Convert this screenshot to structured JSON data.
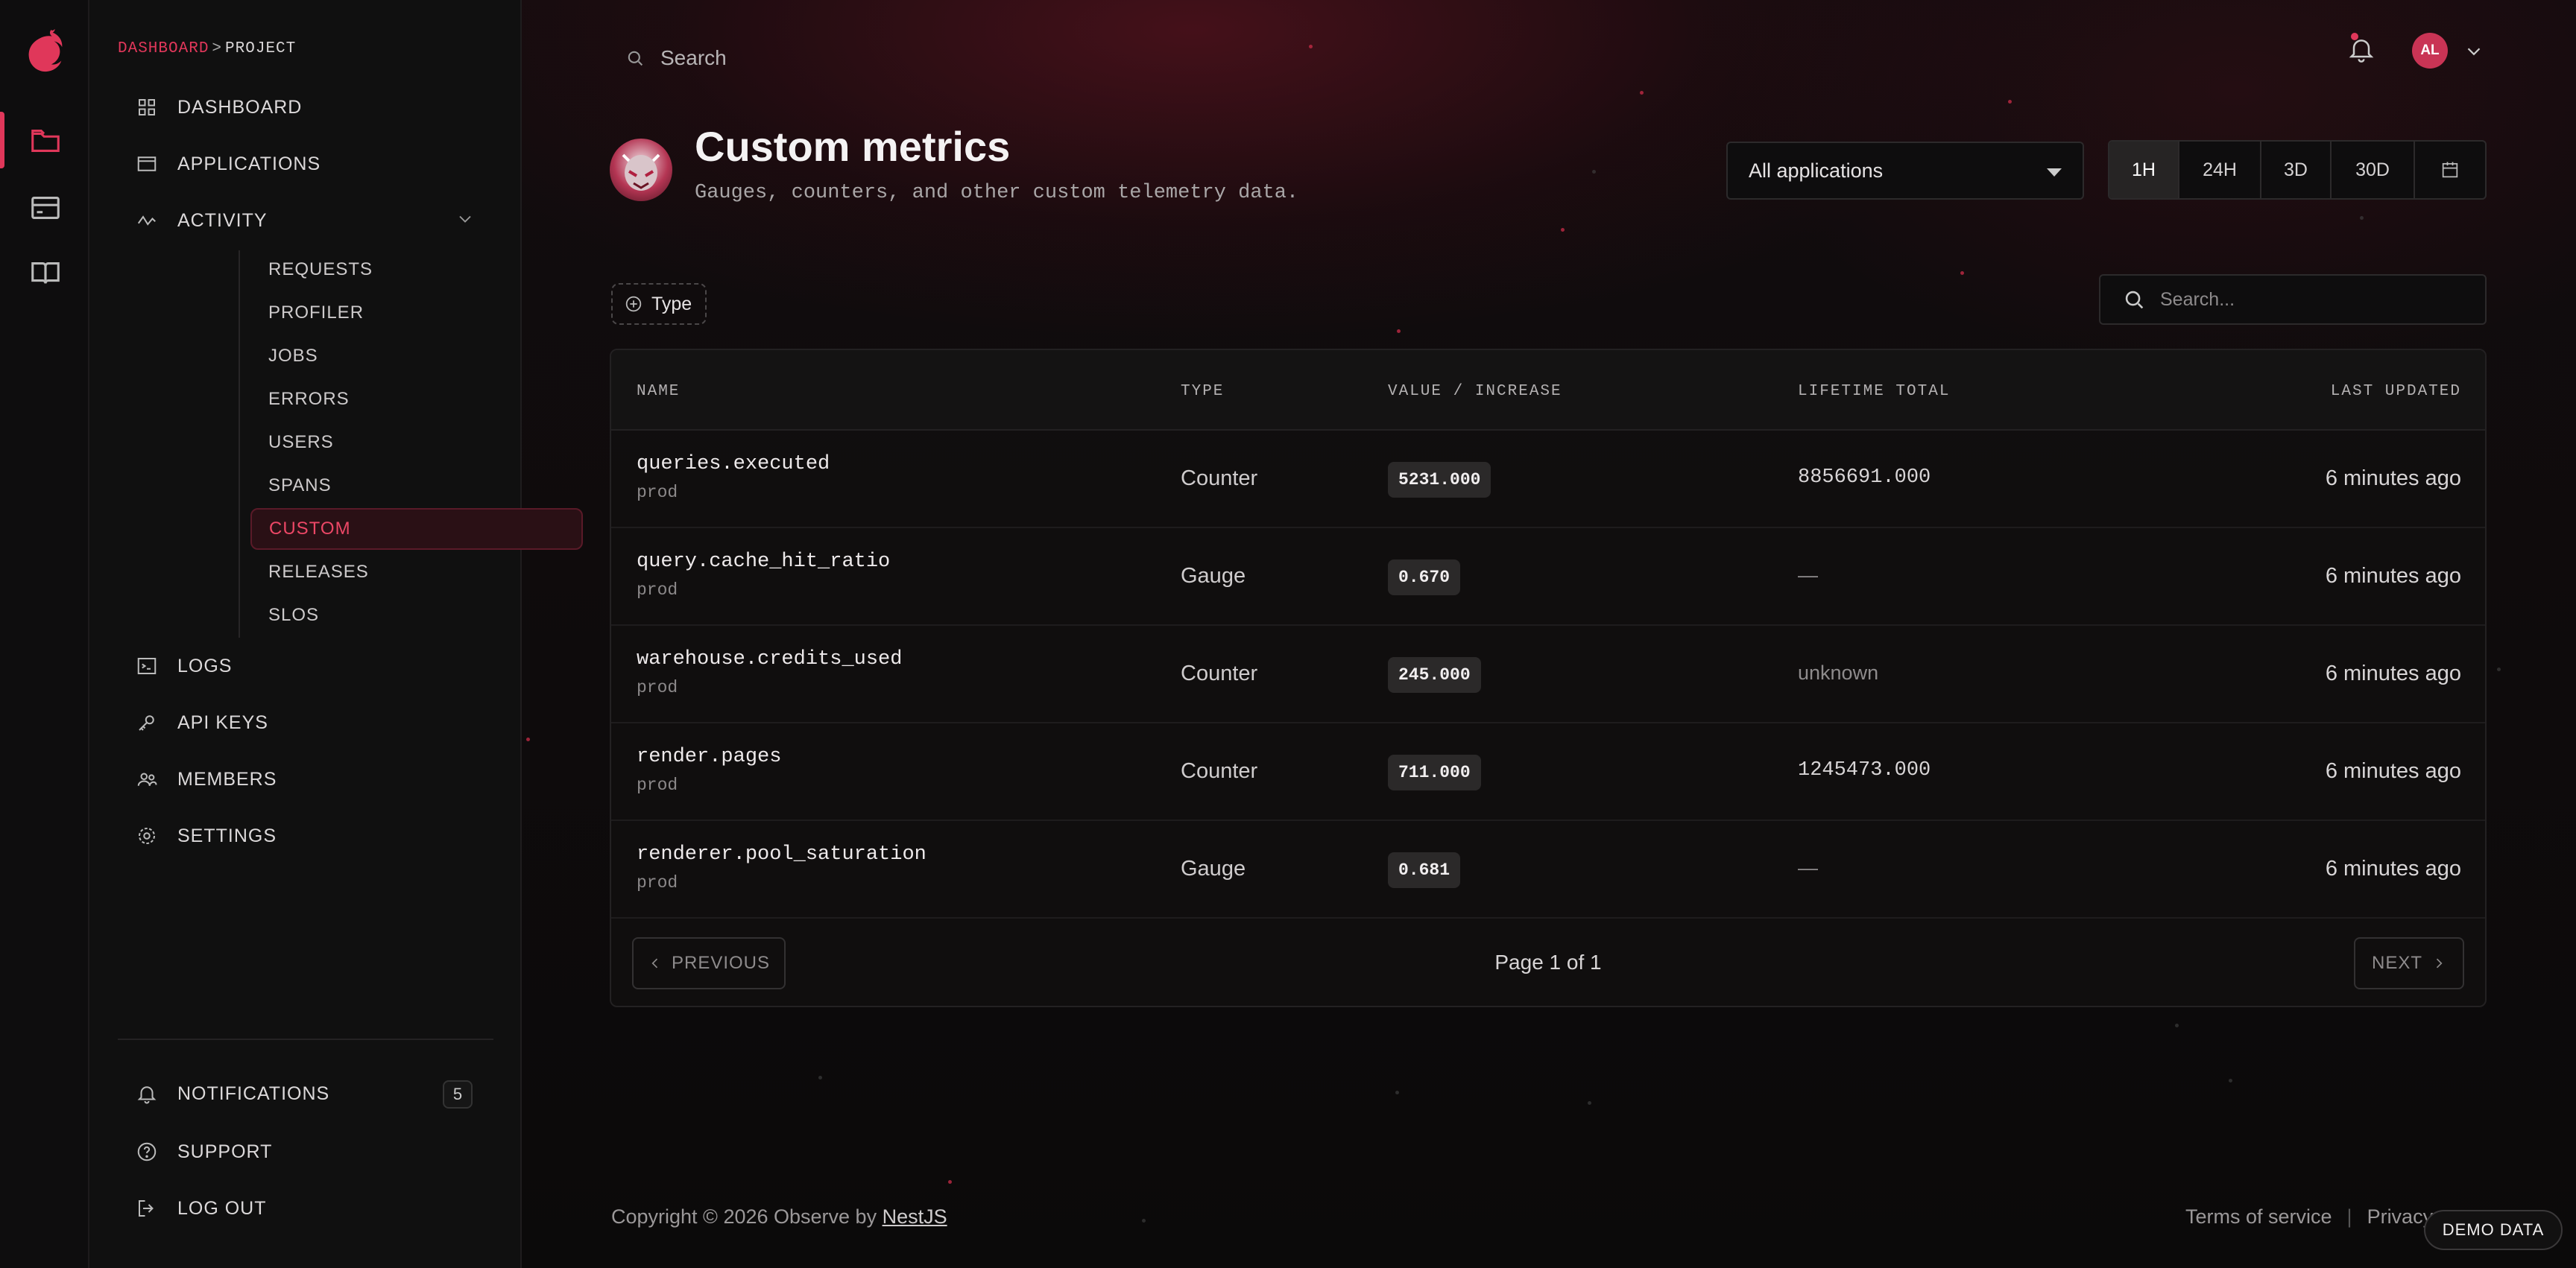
{
  "colors": {
    "accent": "#e0375a",
    "background": "#0c0a0b",
    "surface": "#101010"
  },
  "rail": {
    "icons": [
      "nestjs-logo-icon",
      "folder-icon",
      "card-icon",
      "book-icon"
    ]
  },
  "breadcrumb": {
    "root": "DASHBOARD",
    "separator": ">",
    "current": "PROJECT"
  },
  "sidebar": {
    "items": [
      {
        "label": "DASHBOARD",
        "icon": "grid-icon"
      },
      {
        "label": "APPLICATIONS",
        "icon": "window-icon"
      },
      {
        "label": "ACTIVITY",
        "icon": "activity-icon"
      }
    ],
    "activity_sub": [
      "REQUESTS",
      "PROFILER",
      "JOBS",
      "ERRORS",
      "USERS",
      "SPANS",
      "CUSTOM",
      "RELEASES",
      "SLOS"
    ],
    "active_sub": "CUSTOM",
    "lower_items": [
      {
        "label": "LOGS",
        "icon": "terminal-icon"
      },
      {
        "label": "API KEYS",
        "icon": "key-icon"
      },
      {
        "label": "MEMBERS",
        "icon": "users-icon"
      },
      {
        "label": "SETTINGS",
        "icon": "gear-icon"
      }
    ],
    "bottom_items": [
      {
        "label": "NOTIFICATIONS",
        "icon": "bell-icon"
      },
      {
        "label": "SUPPORT",
        "icon": "help-icon"
      },
      {
        "label": "LOG OUT",
        "icon": "logout-icon"
      }
    ],
    "notifications_count": "5"
  },
  "topbar": {
    "search_placeholder": "Search",
    "avatar_initials": "AL"
  },
  "header": {
    "title": "Custom metrics",
    "subtitle": "Gauges, counters, and other custom telemetry data.",
    "app_select": "All applications",
    "ranges": [
      "1H",
      "24H",
      "3D",
      "30D"
    ],
    "active_range": "1H"
  },
  "filters": {
    "type_chip": "Type",
    "search_placeholder": "Search..."
  },
  "table": {
    "columns": [
      "NAME",
      "TYPE",
      "VALUE / INCREASE",
      "LIFETIME TOTAL",
      "LAST UPDATED"
    ],
    "rows": [
      {
        "name": "queries.executed",
        "env": "prod",
        "type": "Counter",
        "value": "5231.000",
        "total": "8856691.000",
        "updated": "6 minutes ago"
      },
      {
        "name": "query.cache_hit_ratio",
        "env": "prod",
        "type": "Gauge",
        "value": "0.670",
        "total": "—",
        "updated": "6 minutes ago"
      },
      {
        "name": "warehouse.credits_used",
        "env": "prod",
        "type": "Counter",
        "value": "245.000",
        "total": "unknown",
        "updated": "6 minutes ago"
      },
      {
        "name": "render.pages",
        "env": "prod",
        "type": "Counter",
        "value": "711.000",
        "total": "1245473.000",
        "updated": "6 minutes ago"
      },
      {
        "name": "renderer.pool_saturation",
        "env": "prod",
        "type": "Gauge",
        "value": "0.681",
        "total": "—",
        "updated": "6 minutes ago"
      }
    ],
    "pager": {
      "prev": "PREVIOUS",
      "next": "NEXT",
      "info": "Page 1 of 1"
    }
  },
  "footer": {
    "copyright": "Copyright © 2026 Observe by ",
    "brand": "NestJS",
    "terms": "Terms of service",
    "separator": "|",
    "privacy": "Privacy",
    "demo_badge": "DEMO DATA"
  }
}
